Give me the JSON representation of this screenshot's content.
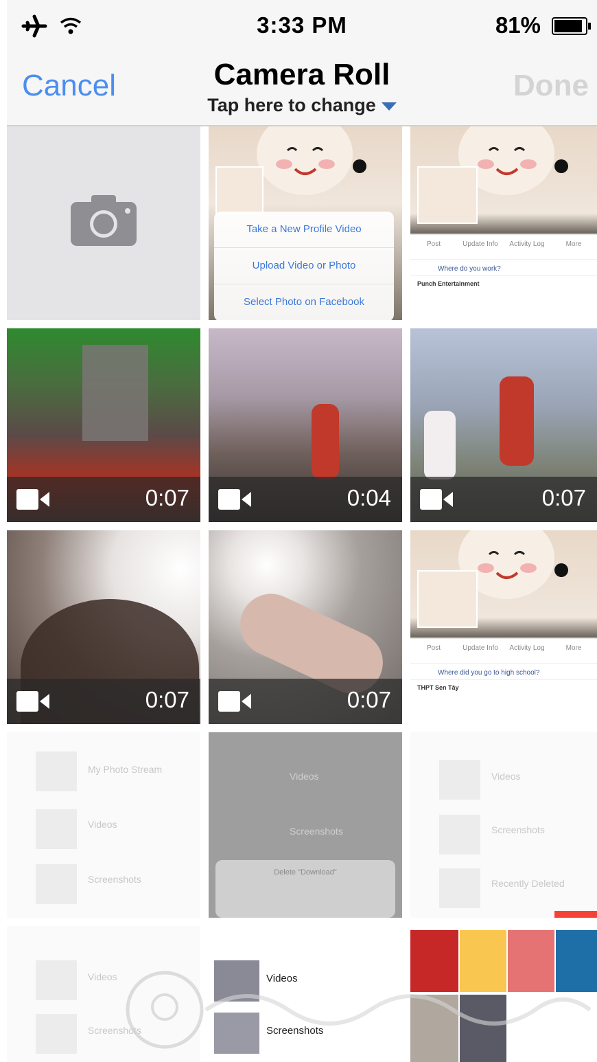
{
  "status_bar": {
    "time": "3:33 PM",
    "battery_percent": "81%",
    "airplane_mode": true,
    "wifi": true
  },
  "nav": {
    "cancel_label": "Cancel",
    "title": "Camera Roll",
    "subtitle": "Tap here to change",
    "done_label": "Done"
  },
  "icons": {
    "camera": "camera-icon",
    "video": "video-camera-icon"
  },
  "colors": {
    "accent": "#4c8ef0",
    "disabled": "#d4d4d4"
  },
  "grid": {
    "screenshot_profile_menu": {
      "items": [
        "Take a New Profile Video",
        "Upload Video or Photo",
        "Select Photo on Facebook"
      ]
    },
    "screenshot_profile_1": {
      "question": "Where do you work?",
      "footer": "Punch Entertainment",
      "icons": [
        "Post",
        "Update Info",
        "Activity Log",
        "More"
      ]
    },
    "screenshot_profile_2": {
      "question": "Where did you go to high school?",
      "footer": "THPT Sen Tây",
      "icons": [
        "Post",
        "Update Info",
        "Activity Log",
        "More"
      ]
    },
    "videos": [
      {
        "duration": "0:07"
      },
      {
        "duration": "0:04"
      },
      {
        "duration": "0:07"
      },
      {
        "duration": "0:07"
      },
      {
        "duration": "0:07"
      }
    ],
    "faded_tile_1": {
      "rows": [
        "My Photo Stream",
        "Videos",
        "Screenshots",
        "Videos",
        "Screenshots"
      ]
    },
    "faded_tile_2": {
      "rows": [
        "Videos",
        "Screenshots"
      ],
      "dialog": "Delete \"Download\""
    },
    "faded_tile_3": {
      "rows": [
        "Videos",
        "Screenshots",
        "Recently Deleted"
      ]
    },
    "bottom_tile_2": {
      "rows": [
        "Videos",
        "Screenshots"
      ]
    }
  }
}
